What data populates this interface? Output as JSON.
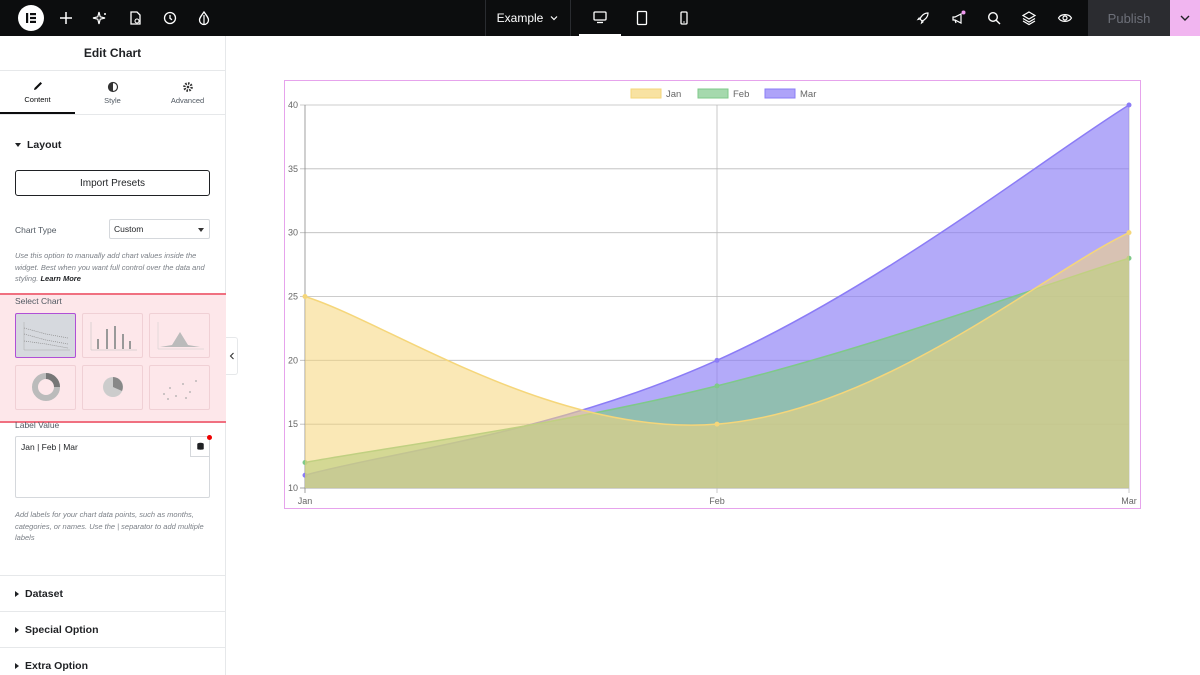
{
  "topbar": {
    "doc_title": "Example",
    "publish_label": "Publish"
  },
  "sidebar": {
    "panel_title": "Edit Chart",
    "tabs": [
      {
        "label": "Content",
        "icon": "pencil-icon"
      },
      {
        "label": "Style",
        "icon": "half-circle-icon"
      },
      {
        "label": "Advanced",
        "icon": "gear-icon"
      }
    ],
    "layout": {
      "title": "Layout",
      "import_label": "Import Presets",
      "chart_type_label": "Chart Type",
      "chart_type_value": "Custom",
      "help_text": "Use this option to manually add chart values inside the widget. Best when you want full control over the data and styling.",
      "learn_more": "Learn More",
      "select_chart_label": "Select Chart",
      "label_value_label": "Label Value",
      "label_value": "Jan | Feb | Mar",
      "label_help": "Add labels for your chart data points, such as months, categories, or names. Use the | separator to add multiple labels"
    },
    "sections": [
      "Dataset",
      "Special Option",
      "Extra Option"
    ]
  },
  "colors": {
    "jan": "#f5d67a",
    "feb": "#7fc98a",
    "mar": "#8b7cf6",
    "highlight": "#f07080",
    "accent": "#b04fd6"
  },
  "chart_data": {
    "type": "area",
    "categories": [
      "Jan",
      "Feb",
      "Mar"
    ],
    "series": [
      {
        "name": "Jan",
        "values": [
          25,
          15,
          30
        ]
      },
      {
        "name": "Feb",
        "values": [
          12,
          18,
          28
        ]
      },
      {
        "name": "Mar",
        "values": [
          11,
          20,
          40
        ]
      }
    ],
    "ylim": [
      10,
      40
    ],
    "yticks": [
      10,
      15,
      20,
      25,
      30,
      35,
      40
    ],
    "legend": "top-center",
    "grid": true
  }
}
